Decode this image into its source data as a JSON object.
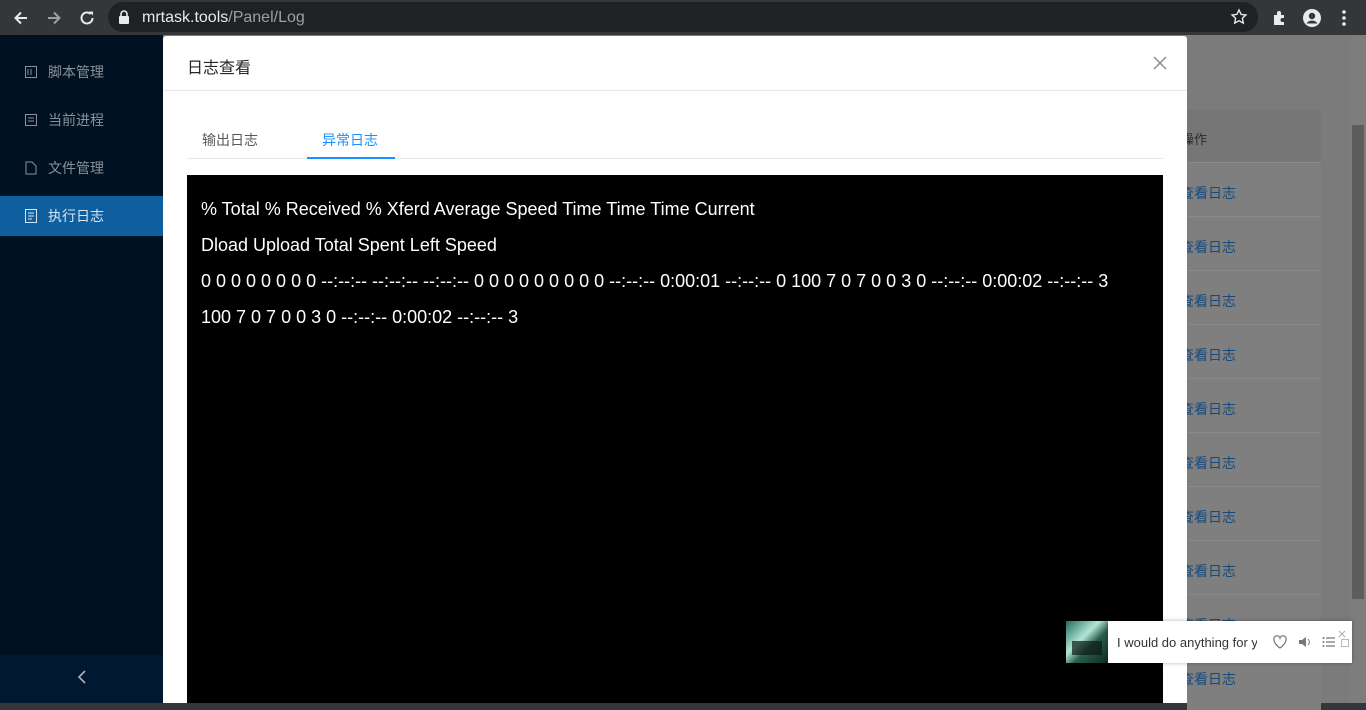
{
  "browser": {
    "url_host": "mrtask.tools",
    "url_path": "/Panel/Log"
  },
  "sidebar": {
    "items": [
      {
        "label": "脚本管理"
      },
      {
        "label": "当前进程"
      },
      {
        "label": "文件管理"
      },
      {
        "label": "执行日志"
      }
    ],
    "active_index": 3
  },
  "background_page": {
    "column_header": "操作",
    "row_link": "查看日志"
  },
  "modal": {
    "title": "日志查看",
    "tabs": [
      {
        "label": "输出日志"
      },
      {
        "label": "异常日志"
      }
    ],
    "active_tab": 1,
    "log_lines": [
      "% Total % Received % Xferd Average Speed Time Time Time Current",
      "Dload Upload Total Spent Left Speed",
      "0 0 0 0 0 0 0 0 --:--:-- --:--:-- --:--:-- 0 0 0 0 0 0 0 0 0 --:--:-- 0:00:01 --:--:-- 0 100 7 0 7 0 0 3 0 --:--:-- 0:00:02 --:--:-- 3",
      "100 7 0 7 0 0 3 0 --:--:-- 0:00:02 --:--:-- 3"
    ]
  },
  "music_player": {
    "track_text": "I would do anything for you"
  },
  "colors": {
    "accent": "#1890ff",
    "sidebar_bg": "#001122",
    "sidebar_active": "#0f5e9e"
  }
}
